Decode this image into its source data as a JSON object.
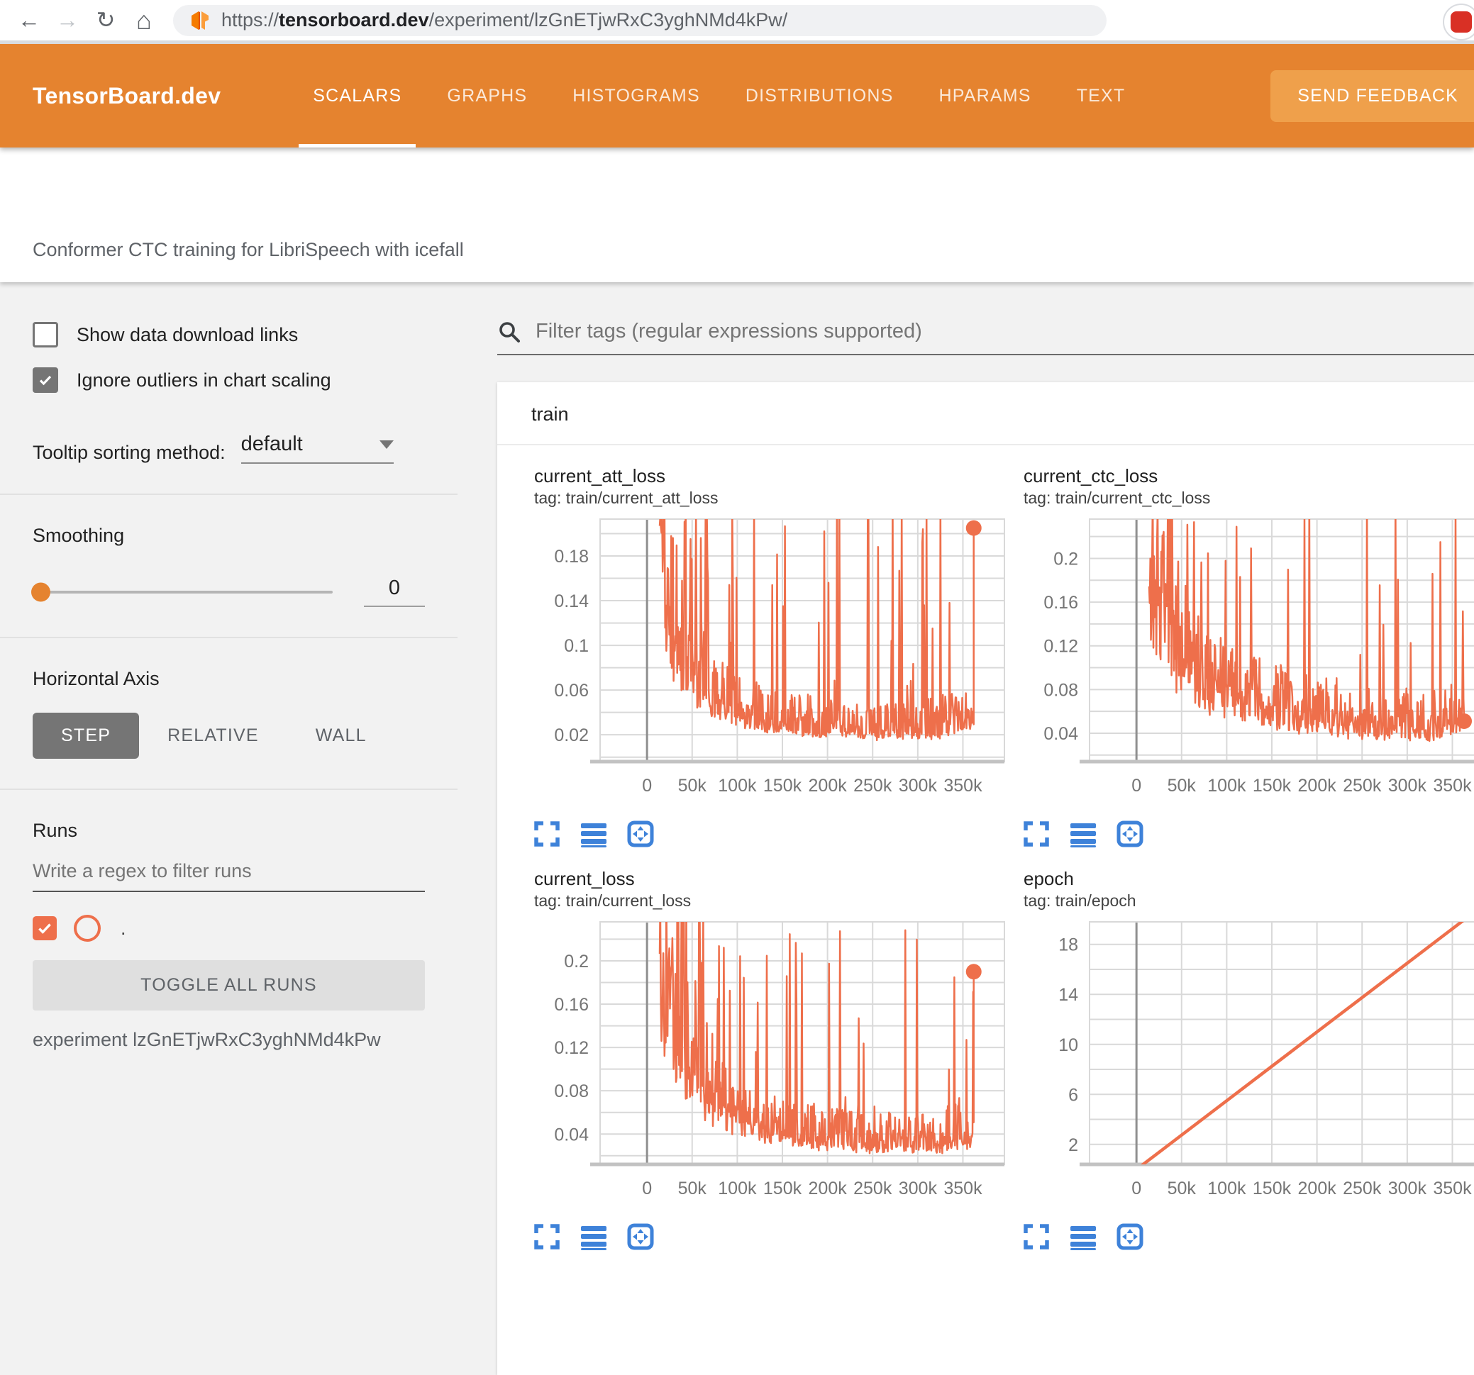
{
  "browser": {
    "url_prefix": "https://",
    "url_domain": "tensorboard.dev",
    "url_path": "/experiment/lzGnETjwRxC3yghNMd4kPw/"
  },
  "header": {
    "logo": "TensorBoard.dev",
    "tabs": [
      {
        "label": "SCALARS",
        "active": true
      },
      {
        "label": "GRAPHS",
        "active": false
      },
      {
        "label": "HISTOGRAMS",
        "active": false
      },
      {
        "label": "DISTRIBUTIONS",
        "active": false
      },
      {
        "label": "HPARAMS",
        "active": false
      },
      {
        "label": "TEXT",
        "active": false
      }
    ],
    "feedback_button": "SEND FEEDBACK"
  },
  "title_bar": {
    "experiment_title": "Conformer CTC training for LibriSpeech with icefall"
  },
  "sidebar": {
    "checkboxes": [
      {
        "label": "Show data download links",
        "checked": false
      },
      {
        "label": "Ignore outliers in chart scaling",
        "checked": true
      }
    ],
    "tooltip_sorting": {
      "label": "Tooltip sorting method:",
      "value": "default"
    },
    "smoothing": {
      "label": "Smoothing",
      "value": "0"
    },
    "horizontal_axis": {
      "label": "Horizontal Axis",
      "options": [
        {
          "label": "STEP",
          "active": true
        },
        {
          "label": "RELATIVE",
          "active": false
        },
        {
          "label": "WALL",
          "active": false
        }
      ]
    },
    "runs": {
      "label": "Runs",
      "filter_placeholder": "Write a regex to filter runs",
      "run_item": {
        "label": ".",
        "checked": true
      },
      "toggle_button": "TOGGLE ALL RUNS",
      "experiment_caption": "experiment lzGnETjwRxC3yghNMd4kPw"
    }
  },
  "main": {
    "filter_placeholder": "Filter tags (regular expressions supported)",
    "group": "train"
  },
  "colors": {
    "header_orange": "#e5832f",
    "feedback_orange": "#efa04b",
    "run_color": "#ee6f4b",
    "icon_blue": "#3e82d9",
    "grid_gray": "#d9d9d9"
  },
  "icons": {
    "browser": [
      "back-arrow",
      "forward-arrow",
      "reload",
      "home",
      "tensorboard-favicon",
      "avatar"
    ],
    "search": "search-icon",
    "dropdown": "caret-down-icon",
    "chart_toolbar": [
      "expand-icon",
      "data-table-icon",
      "fit-domain-icon"
    ]
  },
  "chart_data": {
    "x_axis": {
      "xlim": [
        -52000,
        396000
      ],
      "ticks": [
        [
          0,
          "0"
        ],
        [
          50000,
          "50k"
        ],
        [
          100000,
          "100k"
        ],
        [
          150000,
          "150k"
        ],
        [
          200000,
          "200k"
        ],
        [
          250000,
          "250k"
        ],
        [
          300000,
          "300k"
        ],
        [
          350000,
          "350k"
        ]
      ]
    },
    "charts": [
      {
        "type": "line",
        "title": "current_att_loss",
        "tag": "tag: train/current_att_loss",
        "ylim": [
          -0.004,
          0.213
        ],
        "y_grid_step": 0.02,
        "y_ticks": [
          [
            0.02,
            "0.02"
          ],
          [
            0.06,
            "0.06"
          ],
          [
            0.1,
            "0.1"
          ],
          [
            0.14,
            "0.14"
          ],
          [
            0.18,
            "0.18"
          ]
        ],
        "end_marker": true,
        "series": {
          "style": "noisy",
          "color": "#ee6f4b",
          "width": 2.5,
          "x_start": 14000,
          "x_end": 362000,
          "samples": 520,
          "seed": 11,
          "baseline": [
            [
              14000,
              0.13
            ],
            [
              30000,
              0.08
            ],
            [
              60000,
              0.05
            ],
            [
              100000,
              0.034
            ],
            [
              150000,
              0.025
            ],
            [
              200000,
              0.021
            ],
            [
              260000,
              0.019
            ],
            [
              320000,
              0.019
            ],
            [
              362000,
              0.03
            ]
          ],
          "band": [
            [
              14000,
              0.14
            ],
            [
              40000,
              0.1
            ],
            [
              80000,
              0.05
            ],
            [
              150000,
              0.035
            ],
            [
              250000,
              0.03
            ],
            [
              362000,
              0.04
            ]
          ],
          "spike_prob": [
            [
              14000,
              0.55
            ],
            [
              40000,
              0.25
            ],
            [
              80000,
              0.1
            ],
            [
              150000,
              0.065
            ],
            [
              362000,
              0.065
            ]
          ],
          "final_value": 0.205
        }
      },
      {
        "type": "line",
        "title": "current_ctc_loss",
        "tag": "tag: train/current_ctc_loss",
        "ylim": [
          0.014,
          0.236
        ],
        "y_grid_step": 0.02,
        "y_ticks": [
          [
            0.04,
            "0.04"
          ],
          [
            0.08,
            "0.08"
          ],
          [
            0.12,
            "0.12"
          ],
          [
            0.16,
            "0.16"
          ],
          [
            0.2,
            "0.2"
          ]
        ],
        "end_marker": true,
        "series": {
          "style": "noisy",
          "color": "#ee6f4b",
          "width": 2.5,
          "x_start": 14000,
          "x_end": 363000,
          "samples": 520,
          "seed": 7,
          "baseline": [
            [
              14000,
              0.15
            ],
            [
              40000,
              0.1
            ],
            [
              80000,
              0.072
            ],
            [
              130000,
              0.058
            ],
            [
              190000,
              0.048
            ],
            [
              260000,
              0.042
            ],
            [
              330000,
              0.04
            ],
            [
              363000,
              0.046
            ]
          ],
          "band": [
            [
              14000,
              0.12
            ],
            [
              60000,
              0.08
            ],
            [
              130000,
              0.055
            ],
            [
              220000,
              0.045
            ],
            [
              363000,
              0.045
            ]
          ],
          "spike_prob": [
            [
              14000,
              0.5
            ],
            [
              50000,
              0.22
            ],
            [
              100000,
              0.1
            ],
            [
              180000,
              0.05
            ],
            [
              363000,
              0.05
            ]
          ],
          "final_value": 0.051
        }
      },
      {
        "type": "line",
        "title": "current_loss",
        "tag": "tag: train/current_loss",
        "ylim": [
          0.012,
          0.236
        ],
        "y_grid_step": 0.02,
        "y_ticks": [
          [
            0.04,
            "0.04"
          ],
          [
            0.08,
            "0.08"
          ],
          [
            0.12,
            "0.12"
          ],
          [
            0.16,
            "0.16"
          ],
          [
            0.2,
            "0.2"
          ]
        ],
        "end_marker": true,
        "series": {
          "style": "noisy",
          "color": "#ee6f4b",
          "width": 2.5,
          "x_start": 14000,
          "x_end": 362000,
          "samples": 520,
          "seed": 19,
          "baseline": [
            [
              14000,
              0.14
            ],
            [
              35000,
              0.09
            ],
            [
              70000,
              0.058
            ],
            [
              120000,
              0.042
            ],
            [
              180000,
              0.032
            ],
            [
              250000,
              0.027
            ],
            [
              320000,
              0.027
            ],
            [
              362000,
              0.033
            ]
          ],
          "band": [
            [
              14000,
              0.14
            ],
            [
              50000,
              0.09
            ],
            [
              100000,
              0.05
            ],
            [
              180000,
              0.038
            ],
            [
              362000,
              0.042
            ]
          ],
          "spike_prob": [
            [
              14000,
              0.5
            ],
            [
              50000,
              0.22
            ],
            [
              100000,
              0.09
            ],
            [
              180000,
              0.06
            ],
            [
              362000,
              0.06
            ]
          ],
          "final_value": 0.19
        }
      },
      {
        "type": "line",
        "title": "epoch",
        "tag": "tag: train/epoch",
        "ylim": [
          0.4,
          19.8
        ],
        "y_grid_step": 2,
        "y_ticks": [
          [
            2,
            "2"
          ],
          [
            6,
            "6"
          ],
          [
            10,
            "10"
          ],
          [
            14,
            "14"
          ],
          [
            18,
            "18"
          ]
        ],
        "end_marker": false,
        "series": {
          "style": "segment",
          "color": "#ee6f4b",
          "width": 4.5,
          "points": [
            [
              0,
              0
            ],
            [
              362000,
              19.9
            ]
          ]
        }
      }
    ]
  }
}
